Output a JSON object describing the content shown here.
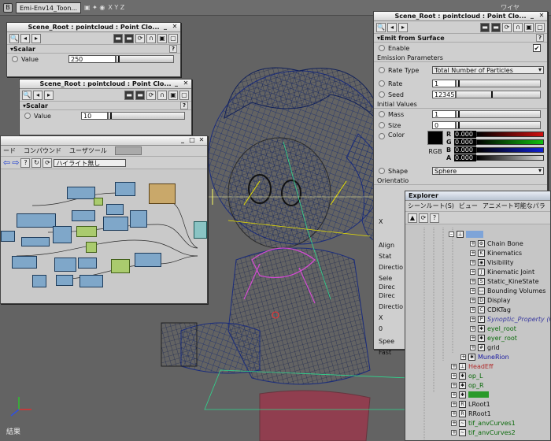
{
  "viewport": {
    "camera_label": "Emi-Env14_Toon...",
    "axes_label": "X Y Z",
    "view_mode_label": "ワイヤ",
    "result_label": "結果"
  },
  "scalar_panel_1": {
    "title": "Scene_Root : pointcloud : Point Clo...",
    "section": "Scalar",
    "value_label": "Value",
    "value": "250",
    "slider_fraction": 0.3
  },
  "scalar_panel_2": {
    "title": "Scene_Root : pointcloud : Point Clo...",
    "section": "Scalar",
    "value_label": "Value",
    "value": "10",
    "slider_fraction": 0.25
  },
  "schematic": {
    "menu": [
      "ード",
      "コンパウンド",
      "ユーザツール"
    ],
    "filter_value": "ハイライト無し"
  },
  "emit_panel": {
    "title": "Scene_Root : pointcloud : Point Clo...",
    "section": "Emit from Surface",
    "enable_label": "Enable",
    "emission_header": "Emission Parameters",
    "rate_type_label": "Rate Type",
    "rate_type_value": "Total Number of Particles",
    "rate_label": "Rate",
    "rate_value": "1",
    "seed_label": "Seed",
    "seed_value": "12345",
    "initial_header": "Initial Values",
    "mass_label": "Mass",
    "mass_value": "1",
    "size_label": "Size",
    "size_value": "0",
    "color_label": "Color",
    "rgb_label": "RGB",
    "color_channels": [
      {
        "ch": "R",
        "value": "0.000",
        "color": "#d01010"
      },
      {
        "ch": "G",
        "value": "0.000",
        "color": "#10c010"
      },
      {
        "ch": "B",
        "value": "0.000",
        "color": "#1020d0"
      },
      {
        "ch": "A",
        "value": "0.000",
        "color": "#d8d8d8"
      }
    ],
    "shape_label": "Shape",
    "shape_value": "Sphere",
    "orientation_header": "Orientatio",
    "partial_labels": [
      "X",
      "Align",
      "Stat",
      "Directio",
      "Sele",
      "Direc",
      "Direc",
      "Directio",
      "X",
      "0",
      "Spee",
      "Fast"
    ]
  },
  "explorer": {
    "title": "Explorer",
    "menu": [
      "シーンルート(S)",
      "ビュー",
      "アニメート可能なパラ"
    ],
    "items": [
      {
        "label": "Chain Bone",
        "indent": 1,
        "color": "#111111",
        "icon": "gear-icon"
      },
      {
        "label": "Kinematics",
        "indent": 1,
        "color": "#111111",
        "icon": "kinematics-icon"
      },
      {
        "label": "Visibility",
        "indent": 1,
        "color": "#111111",
        "icon": "eye-icon"
      },
      {
        "label": "Kinematic Joint",
        "indent": 1,
        "color": "#111111",
        "icon": "joint-icon"
      },
      {
        "label": "Static_KineState",
        "indent": 1,
        "color": "#111111",
        "icon": "state-icon"
      },
      {
        "label": "Bounding Volumes",
        "indent": 1,
        "color": "#111111",
        "icon": "bbox-icon"
      },
      {
        "label": "Display",
        "indent": 1,
        "color": "#111111",
        "icon": "display-icon"
      },
      {
        "label": "CDKTag",
        "indent": 1,
        "color": "#111111",
        "icon": "tag-icon"
      },
      {
        "label": "Synoptic_Property (Glob",
        "indent": 1,
        "color": "#3a3aa0",
        "icon": "property-icon"
      },
      {
        "label": "eyel_root",
        "indent": 1,
        "color": "#0a6a0a",
        "icon": "null-icon"
      },
      {
        "label": "eyer_root",
        "indent": 1,
        "color": "#0a6a0a",
        "icon": "null-icon"
      },
      {
        "label": "grid",
        "indent": 1,
        "color": "#111111",
        "icon": "grid-icon"
      },
      {
        "label": "MuneRion",
        "indent": 0,
        "color": "#1a1aa0",
        "icon": "bone-icon"
      },
      {
        "label": "HeadEff",
        "indent": -1,
        "color": "#b02a2a",
        "icon": "effector-icon"
      },
      {
        "label": "op_L",
        "indent": -1,
        "color": "#0a6a0a",
        "icon": "null-icon"
      },
      {
        "label": "op_R",
        "indent": -1,
        "color": "#0a6a0a",
        "icon": "null-icon"
      },
      {
        "label": "",
        "indent": -1,
        "color": "#0a6a0a",
        "icon": "null-icon"
      },
      {
        "label": "LRoot1",
        "indent": -1,
        "color": "#111111",
        "icon": "root-icon"
      },
      {
        "label": "RRoot1",
        "indent": -1,
        "color": "#111111",
        "icon": "root-icon"
      },
      {
        "label": "tif_anvCurves1",
        "indent": -1,
        "color": "#0a6a0a",
        "icon": "curve-icon"
      },
      {
        "label": "tif_anvCurves2",
        "indent": -1,
        "color": "#0a6a0a",
        "icon": "curve-icon"
      }
    ]
  }
}
